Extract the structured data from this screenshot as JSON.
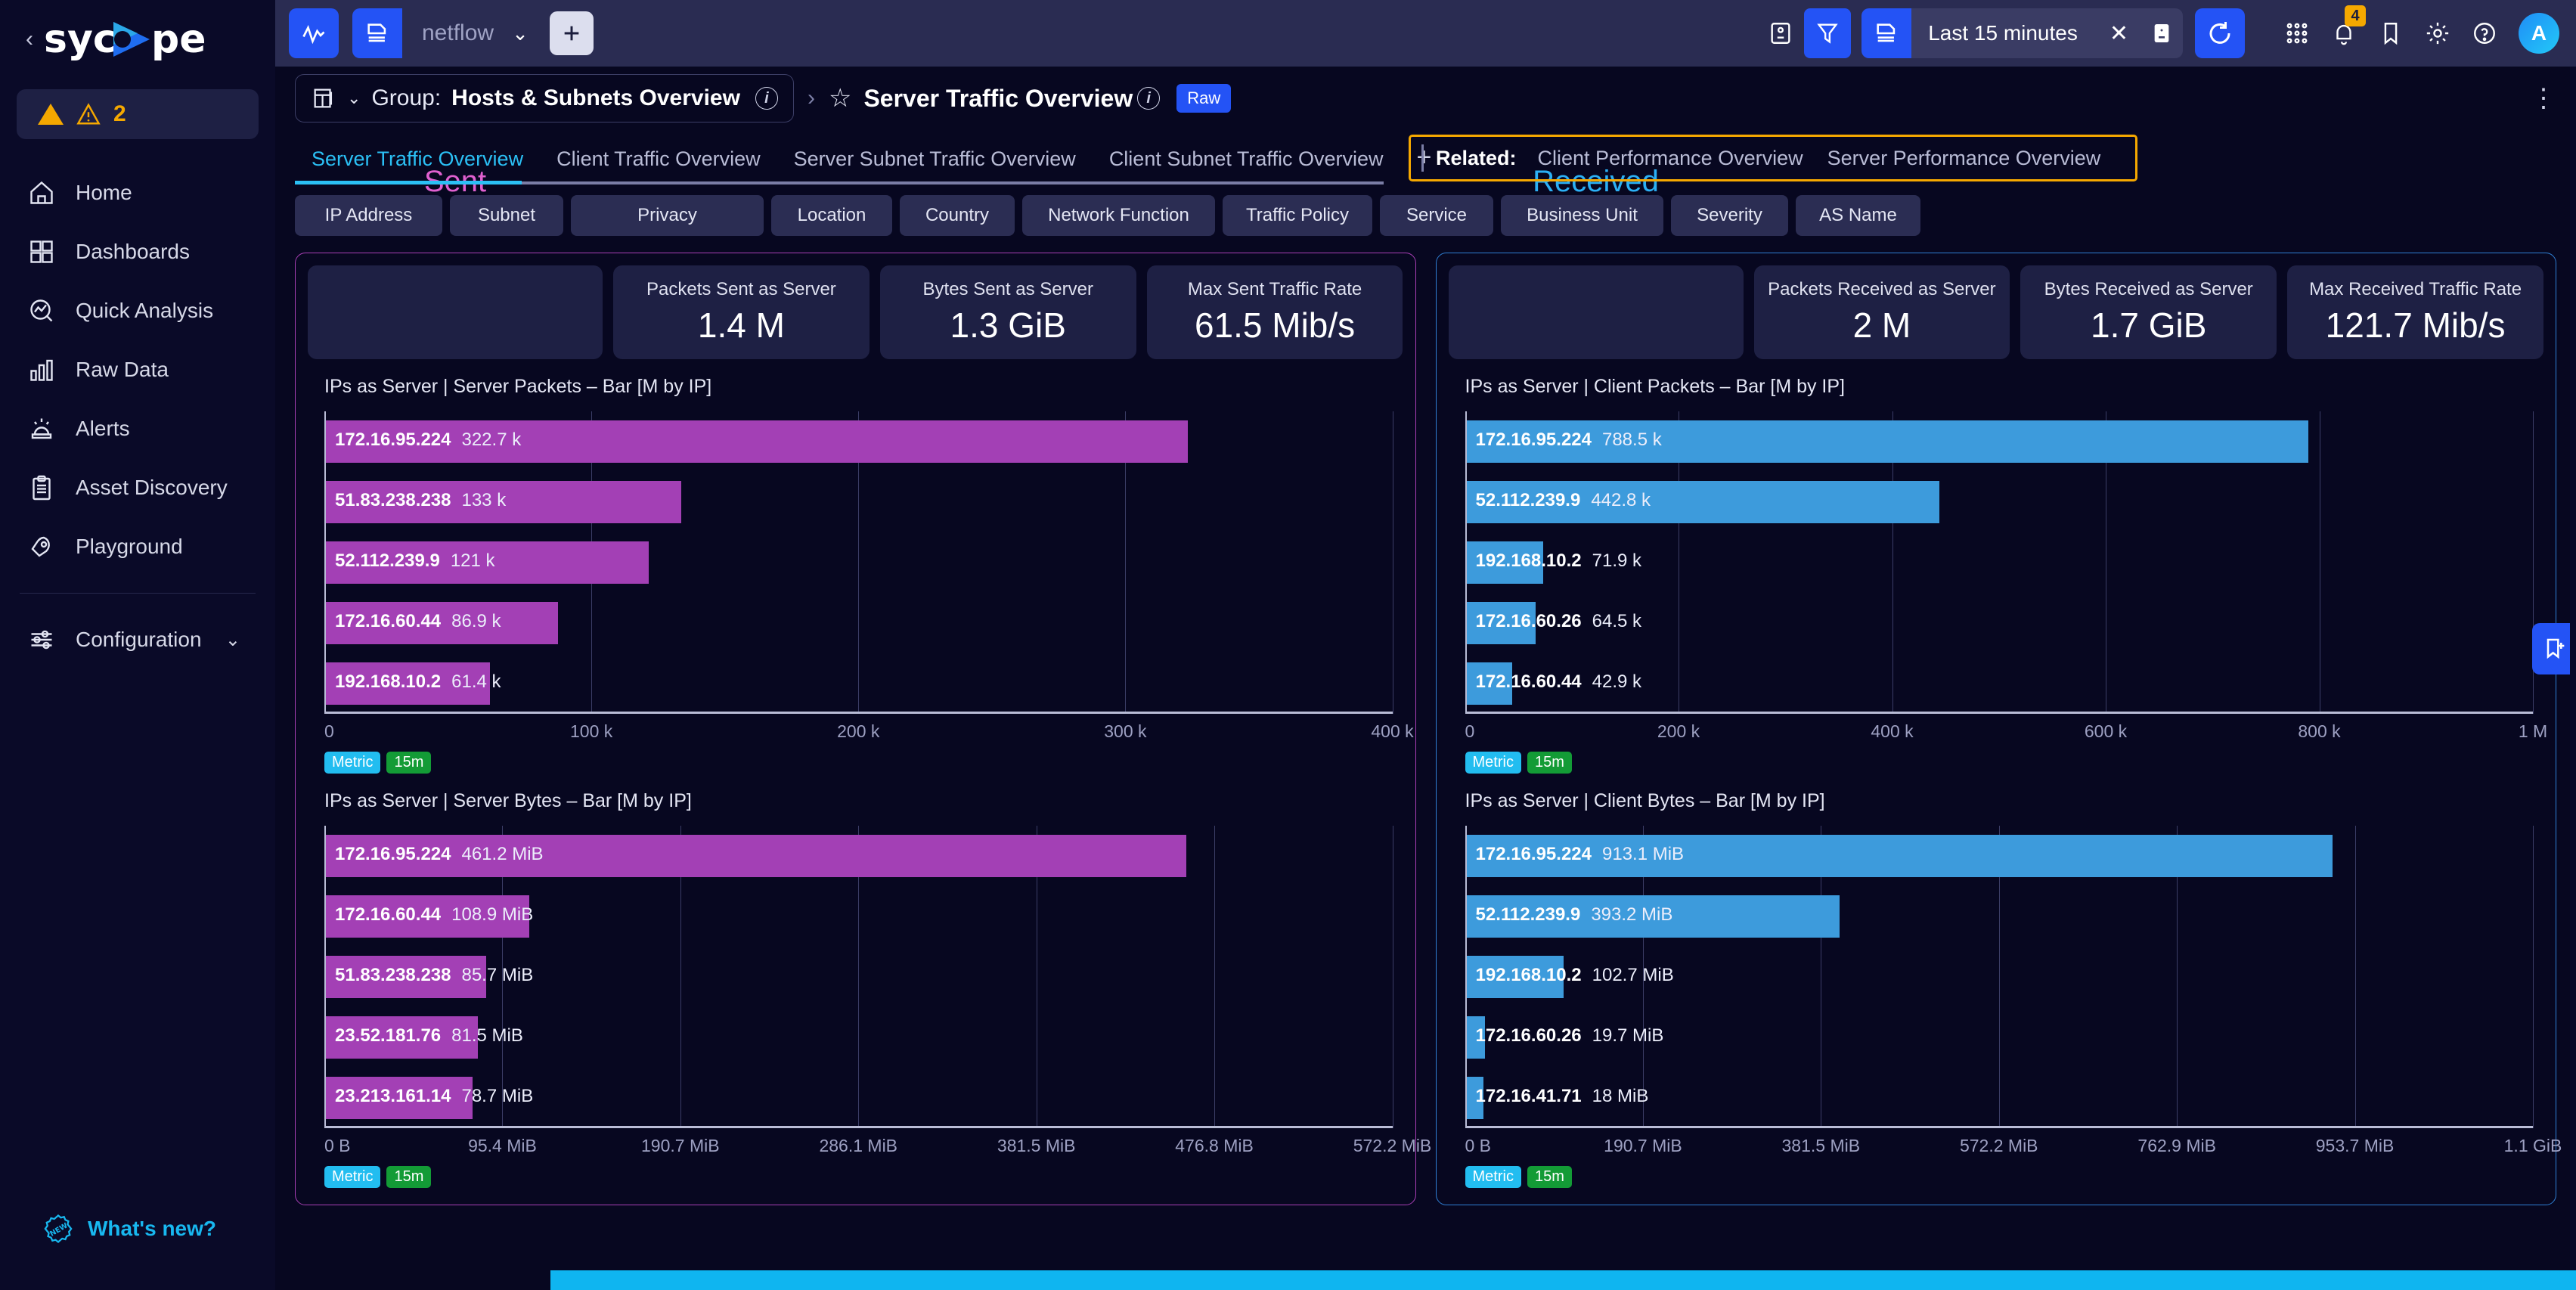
{
  "brand": {
    "name": "sycope",
    "collapse_icon": "chevron-left-icon"
  },
  "sidebar": {
    "alert": {
      "count": "2",
      "icon": "warning-triangle-icon"
    },
    "items": [
      {
        "label": "Home",
        "icon": "home-icon"
      },
      {
        "label": "Dashboards",
        "icon": "grid-icon"
      },
      {
        "label": "Quick Analysis",
        "icon": "analysis-magnifier-icon"
      },
      {
        "label": "Raw Data",
        "icon": "bar-chart-icon"
      },
      {
        "label": "Alerts",
        "icon": "siren-icon"
      },
      {
        "label": "Asset Discovery",
        "icon": "clipboard-icon"
      },
      {
        "label": "Playground",
        "icon": "rocket-icon"
      }
    ],
    "config": {
      "label": "Configuration",
      "icon": "sliders-icon",
      "caret": "chevron-down-icon"
    },
    "whats_new": {
      "label": "What's new?",
      "icon": "new-badge-icon"
    }
  },
  "toolbar": {
    "activity_icon": "pulse-icon",
    "source_icon": "data-source-icon",
    "source_name": "netflow",
    "source_caret": "chevron-down-icon",
    "add_label": "+",
    "save_filter_icon": "save-icon",
    "filter_icon": "funnel-icon",
    "time_icon": "data-source-icon",
    "time_range": "Last 15 minutes",
    "time_clear": "×",
    "time_save_icon": "save-icon",
    "refresh_icon": "refresh-icon",
    "apps_icon": "apps-grid-icon",
    "bell_icon": "bell-icon",
    "bell_badge": "4",
    "bookmark_icon": "bookmark-icon",
    "settings_icon": "gear-icon",
    "help_icon": "help-icon",
    "avatar_initial": "A"
  },
  "breadcrumb": {
    "group_icon": "dashboards-stack-icon",
    "group_caret": "chevron-down-icon",
    "group_prefix": "Group:",
    "group_name": "Hosts & Subnets Overview",
    "group_info": "info-icon",
    "separator": "›",
    "favorite_icon": "star-icon",
    "page_title": "Server Traffic Overview",
    "page_info": "info-icon",
    "raw_badge": "Raw",
    "kebab_icon": "more-vertical-icon"
  },
  "tabs": {
    "items": [
      {
        "label": "Server Traffic Overview",
        "active": true
      },
      {
        "label": "Client Traffic Overview",
        "active": false
      },
      {
        "label": "Server Subnet Traffic Overview",
        "active": false
      },
      {
        "label": "Client Subnet Traffic Overview",
        "active": false
      }
    ],
    "add_tab": "+",
    "related": {
      "label": "Related:",
      "links": [
        "Client Performance Overview",
        "Server Performance Overview"
      ],
      "highlight_color": "#f5a800"
    }
  },
  "chips": [
    {
      "label": "IP Address",
      "width": 108
    },
    {
      "label": "Subnet",
      "width": 92
    },
    {
      "label": "Privacy",
      "width": 190
    },
    {
      "label": "Location",
      "width": 112
    },
    {
      "label": "Country",
      "width": 106
    },
    {
      "label": "Network Function",
      "width": 178
    },
    {
      "label": "Traffic Policy",
      "width": 140
    },
    {
      "label": "Service",
      "width": 104
    },
    {
      "label": "Business Unit",
      "width": 152
    },
    {
      "label": "Severity",
      "width": 108
    },
    {
      "label": "AS Name",
      "width": 112
    }
  ],
  "panels": {
    "sent": {
      "direction": "Sent",
      "accent": "#a83fb5",
      "kpis": [
        {
          "label": "Packets Sent as Server",
          "value": "1.4 M"
        },
        {
          "label": "Bytes Sent as Server",
          "value": "1.3 GiB"
        },
        {
          "label": "Max Sent Traffic Rate",
          "value": "61.5 Mib/s"
        }
      ]
    },
    "received": {
      "direction": "Received",
      "accent": "#2f7fd4",
      "kpis": [
        {
          "label": "Packets Received as Server",
          "value": "2 M"
        },
        {
          "label": "Bytes Received as Server",
          "value": "1.7 GiB"
        },
        {
          "label": "Max Received Traffic Rate",
          "value": "121.7 Mib/s"
        }
      ]
    }
  },
  "chart_data": [
    {
      "id": "server-packets",
      "type": "bar",
      "orientation": "horizontal",
      "title": "IPs as Server | Server Packets – Bar [M by IP]",
      "color": "#a340b5",
      "categories": [
        "172.16.95.224",
        "51.83.238.238",
        "52.112.239.9",
        "172.16.60.44",
        "192.168.10.2"
      ],
      "values": [
        322700,
        133000,
        121000,
        86900,
        61400
      ],
      "value_labels": [
        "322.7 k",
        "133 k",
        "121 k",
        "86.9 k",
        "61.4 k"
      ],
      "xlabel": "",
      "ylabel": "",
      "xlim": [
        0,
        400000
      ],
      "ticks": [
        "0",
        "100 k",
        "200 k",
        "300 k",
        "400 k"
      ],
      "tick_positions": [
        0,
        25,
        50,
        75,
        100
      ],
      "grid": true,
      "badges": [
        "Metric",
        "15m"
      ]
    },
    {
      "id": "client-packets",
      "type": "bar",
      "orientation": "horizontal",
      "title": "IPs as Server | Client Packets – Bar [M by IP]",
      "color": "#3d9bdc",
      "categories": [
        "172.16.95.224",
        "52.112.239.9",
        "192.168.10.2",
        "172.16.60.26",
        "172.16.60.44"
      ],
      "values": [
        788500,
        442800,
        71900,
        64500,
        42900
      ],
      "value_labels": [
        "788.5 k",
        "442.8 k",
        "71.9 k",
        "64.5 k",
        "42.9 k"
      ],
      "xlabel": "",
      "ylabel": "",
      "xlim": [
        0,
        1000000
      ],
      "ticks": [
        "0",
        "200 k",
        "400 k",
        "600 k",
        "800 k",
        "1 M"
      ],
      "tick_positions": [
        0,
        20,
        40,
        60,
        80,
        100
      ],
      "grid": true,
      "badges": [
        "Metric",
        "15m"
      ]
    },
    {
      "id": "server-bytes",
      "type": "bar",
      "orientation": "horizontal",
      "title": "IPs as Server | Server Bytes – Bar [M by IP]",
      "color": "#a340b5",
      "categories": [
        "172.16.95.224",
        "172.16.60.44",
        "51.83.238.238",
        "23.52.181.76",
        "23.213.161.14"
      ],
      "values": [
        461.2,
        108.9,
        85.7,
        81.5,
        78.7
      ],
      "value_labels": [
        "461.2 MiB",
        "108.9 MiB",
        "85.7 MiB",
        "81.5 MiB",
        "78.7 MiB"
      ],
      "xlabel": "",
      "ylabel": "",
      "xlim": [
        0,
        572.2
      ],
      "ticks": [
        "0 B",
        "95.4 MiB",
        "190.7 MiB",
        "286.1 MiB",
        "381.5 MiB",
        "476.8 MiB",
        "572.2 MiB"
      ],
      "tick_positions": [
        0,
        16.67,
        33.33,
        50,
        66.67,
        83.33,
        100
      ],
      "grid": true,
      "badges": [
        "Metric",
        "15m"
      ]
    },
    {
      "id": "client-bytes",
      "type": "bar",
      "orientation": "horizontal",
      "title": "IPs as Server | Client Bytes – Bar [M by IP]",
      "color": "#3d9bdc",
      "categories": [
        "172.16.95.224",
        "52.112.239.9",
        "192.168.10.2",
        "172.16.60.26",
        "172.16.41.71"
      ],
      "values": [
        913.1,
        393.2,
        102.7,
        19.7,
        18
      ],
      "value_labels": [
        "913.1 MiB",
        "393.2 MiB",
        "102.7 MiB",
        "19.7 MiB",
        "18 MiB"
      ],
      "xlabel": "",
      "ylabel": "",
      "xlim": [
        0,
        1126.4
      ],
      "ticks": [
        "0 B",
        "190.7 MiB",
        "381.5 MiB",
        "572.2 MiB",
        "762.9 MiB",
        "953.7 MiB",
        "1.1 GiB"
      ],
      "tick_positions": [
        0,
        16.67,
        33.33,
        50,
        66.67,
        83.33,
        100
      ],
      "grid": true,
      "badges": [
        "Metric",
        "15m"
      ]
    }
  ],
  "edge_tab": {
    "icon": "bookmark-add-icon"
  }
}
